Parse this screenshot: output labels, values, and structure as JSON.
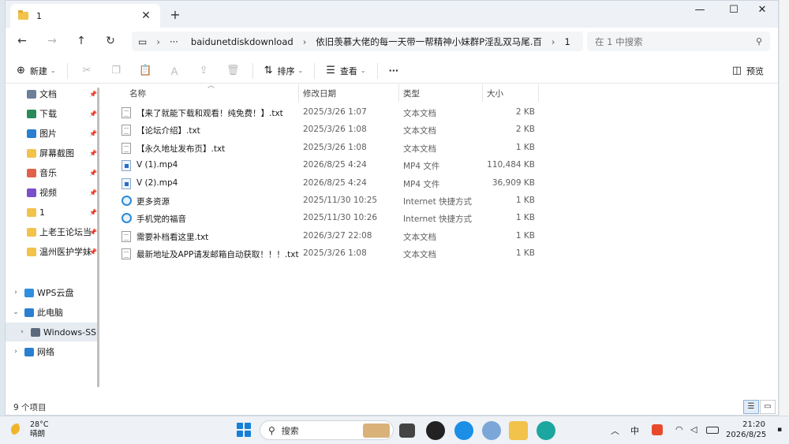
{
  "window": {
    "tab_title": "1",
    "tab_close": "✕",
    "new_tab": "+",
    "minimize": "—",
    "maximize": "☐",
    "close": "✕"
  },
  "nav": {
    "back": "←",
    "forward": "→",
    "up": "↑",
    "refresh": "↻",
    "breadcrumb": [
      "baidunetdiskdownload",
      "依旧羡慕大佬的每一天带一帮精神小妹群P淫乱双马尾.百",
      "1"
    ],
    "more": "···",
    "search_placeholder": "在 1 中搜索"
  },
  "toolbar": {
    "new_label": "新建",
    "sort_label": "排序",
    "view_label": "查看",
    "more": "···",
    "preview_label": "预览"
  },
  "sidebar": {
    "quick": [
      {
        "label": "文档",
        "icon": "document-icon",
        "color": "#6b7f99"
      },
      {
        "label": "下载",
        "icon": "download-icon",
        "color": "#2a8a5a"
      },
      {
        "label": "图片",
        "icon": "picture-icon",
        "color": "#2a7fd0"
      },
      {
        "label": "屏幕截图",
        "icon": "folder-icon",
        "color": "#f2c24b"
      },
      {
        "label": "音乐",
        "icon": "music-icon",
        "color": "#e0624a"
      },
      {
        "label": "视频",
        "icon": "video-icon",
        "color": "#7b4fc9"
      },
      {
        "label": "1",
        "icon": "folder-icon",
        "color": "#f2c24b"
      },
      {
        "label": "上老王论坛当",
        "icon": "folder-icon",
        "color": "#f2c24b"
      },
      {
        "label": "温州医护学妹",
        "icon": "folder-icon",
        "color": "#f2c24b"
      }
    ],
    "tree": [
      {
        "label": "WPS云盘",
        "icon": "cloud-icon",
        "color": "#2f8ee0",
        "expander": "›"
      },
      {
        "label": "此电脑",
        "icon": "computer-icon",
        "color": "#2a7fd0",
        "expander": "⌄"
      },
      {
        "label": "Windows-SSD",
        "icon": "drive-icon",
        "color": "#5a6b7d",
        "expander": "›"
      },
      {
        "label": "网络",
        "icon": "network-icon",
        "color": "#2a7fd0",
        "expander": "›"
      }
    ]
  },
  "columns": {
    "name": "名称",
    "date": "修改日期",
    "type": "类型",
    "size": "大小"
  },
  "files": [
    {
      "name": "【来了就能下载和观看！纯免费！】.txt",
      "date": "2025/3/26 1:07",
      "type": "文本文档",
      "size": "2 KB",
      "kind": "txt"
    },
    {
      "name": "【论坛介绍】.txt",
      "date": "2025/3/26 1:08",
      "type": "文本文档",
      "size": "2 KB",
      "kind": "txt"
    },
    {
      "name": "【永久地址发布页】.txt",
      "date": "2025/3/26 1:08",
      "type": "文本文档",
      "size": "1 KB",
      "kind": "txt"
    },
    {
      "name": "V (1).mp4",
      "date": "2026/8/25 4:24",
      "type": "MP4 文件",
      "size": "110,484 KB",
      "kind": "mp4"
    },
    {
      "name": "V (2).mp4",
      "date": "2026/8/25 4:24",
      "type": "MP4 文件",
      "size": "36,909 KB",
      "kind": "mp4"
    },
    {
      "name": "更多资源",
      "date": "2025/11/30 10:25",
      "type": "Internet 快捷方式",
      "size": "1 KB",
      "kind": "url"
    },
    {
      "name": "手机党的福音",
      "date": "2025/11/30 10:26",
      "type": "Internet 快捷方式",
      "size": "1 KB",
      "kind": "url"
    },
    {
      "name": "需要补档看这里.txt",
      "date": "2026/3/27 22:08",
      "type": "文本文档",
      "size": "1 KB",
      "kind": "txt"
    },
    {
      "name": "最新地址及APP请发邮箱自动获取！！！.txt",
      "date": "2025/3/26 1:08",
      "type": "文本文档",
      "size": "1 KB",
      "kind": "txt"
    }
  ],
  "status": {
    "count": "9 个项目"
  },
  "taskbar": {
    "temperature": "28°C",
    "weather": "晴朗",
    "search_placeholder": "搜索",
    "ime": "中",
    "time": "21:20",
    "date": "2026/8/25"
  }
}
